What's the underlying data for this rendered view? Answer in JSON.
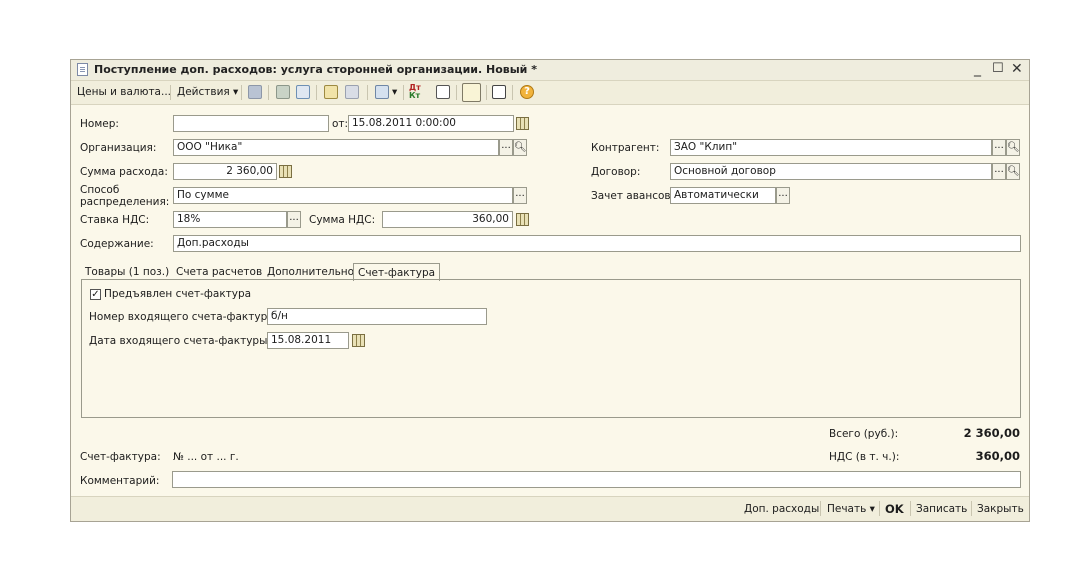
{
  "window": {
    "title": "Поступление доп. расходов: услуга сторонней организации. Новый *",
    "minimize": "_",
    "maximize": "☐",
    "close": "✕"
  },
  "toolbar": {
    "prices_currency": "Цены и валюта...",
    "actions": "Действия"
  },
  "form": {
    "number_label": "Номер:",
    "number_value": "",
    "date_label": "от:",
    "date_value": "15.08.2011  0:00:00",
    "org_label": "Организация:",
    "org_value": "ООО \"Ника\"",
    "sum_label": "Сумма расхода:",
    "sum_value": "2 360,00",
    "method_label": "Способ распределения:",
    "method_value": "По сумме",
    "vat_rate_label": "Ставка НДС:",
    "vat_rate_value": "18%",
    "vat_sum_label": "Сумма НДС:",
    "vat_sum_value": "360,00",
    "contractor_label": "Контрагент:",
    "contractor_value": "ЗАО \"Клип\"",
    "contract_label": "Договор:",
    "contract_value": "Основной договор",
    "advance_label": "Зачет авансов:",
    "advance_value": "Автоматически",
    "content_label": "Содержание:",
    "content_value": "Доп.расходы"
  },
  "tabs": [
    {
      "label": "Товары (1 поз.)"
    },
    {
      "label": "Счета расчетов"
    },
    {
      "label": "Дополнительно"
    },
    {
      "label": "Счет-фактура"
    }
  ],
  "invoice_tab": {
    "presented_label": "Предъявлен счет-фактура",
    "presented_checked": true,
    "in_number_label": "Номер входящего счета-фактуры:",
    "in_number_value": "б/н",
    "in_date_label": "Дата входящего счета-фактуры:",
    "in_date_value": "15.08.2011"
  },
  "totals": {
    "total_label": "Всего (руб.):",
    "total_value": "2 360,00",
    "vat_label": "НДС (в т. ч.):",
    "vat_value": "360,00"
  },
  "footer": {
    "invoice_label": "Счет-фактура:",
    "invoice_value": "№  ...  от  ...  г.",
    "comment_label": "Комментарий:",
    "comment_value": ""
  },
  "bottom_buttons": {
    "add_expenses": "Доп. расходы",
    "print": "Печать",
    "ok": "OK",
    "save": "Записать",
    "close": "Закрыть"
  }
}
